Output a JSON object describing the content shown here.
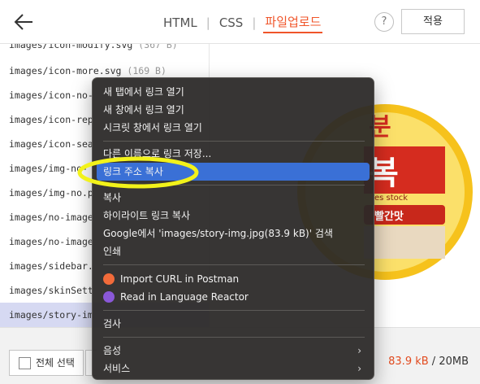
{
  "header": {
    "tabs": [
      {
        "label": "HTML",
        "active": false
      },
      {
        "label": "CSS",
        "active": false
      },
      {
        "label": "파일업로드",
        "active": true
      }
    ],
    "help_label": "?",
    "apply_label": "적용"
  },
  "files": [
    {
      "name": "images/icon-modify.svg",
      "size": "(367 B)"
    },
    {
      "name": "images/icon-more.svg",
      "size": "(169 B)"
    },
    {
      "name": "images/icon-no-",
      "size": ""
    },
    {
      "name": "images/icon-rep",
      "size": ""
    },
    {
      "name": "images/icon-sea",
      "size": ""
    },
    {
      "name": "images/img-no-",
      "size": ""
    },
    {
      "name": "images/img-no.p",
      "size": ""
    },
    {
      "name": "images/no-image",
      "size": ""
    },
    {
      "name": "images/no-image",
      "size": ""
    },
    {
      "name": "images/sidebar.",
      "size": ""
    },
    {
      "name": "images/skinSett",
      "size": ""
    },
    {
      "name": "images/story-im",
      "size": "",
      "selected": true
    }
  ],
  "preview": {
    "text_large_1": "분",
    "text_large_2": "복",
    "text_small": "es stock",
    "text_badge": "빨간맛"
  },
  "footer": {
    "select_all_label": "전체 선택",
    "storage_used": "83.9 kB",
    "storage_total": " / 20MB"
  },
  "context_menu": {
    "items": [
      {
        "label": "새 탭에서 링크 열기"
      },
      {
        "label": "새 창에서 링크 열기"
      },
      {
        "label": "시크릿 창에서 링크 열기"
      },
      {
        "label": "다른 이름으로 링크 저장..."
      },
      {
        "label": "링크 주소 복사",
        "highlighted": true
      },
      {
        "label": "복사"
      },
      {
        "label": "하이라이트 링크 복사"
      },
      {
        "label": "Google에서 'images/story-img.jpg(83.9 kB)' 검색"
      },
      {
        "label": "인쇄"
      },
      {
        "label": "Import CURL in Postman",
        "icon": "postman-icon"
      },
      {
        "label": "Read in Language Reactor",
        "icon": "language-reactor-icon"
      },
      {
        "label": "검사"
      },
      {
        "label": "음성",
        "submenu": true
      },
      {
        "label": "서비스",
        "submenu": true
      }
    ],
    "submenu_arrow": "›"
  },
  "colors": {
    "accent": "#f0552a",
    "menu_highlight": "#3a70d6",
    "annotation": "#f2f21a",
    "selected_row": "#d6d9f2"
  }
}
